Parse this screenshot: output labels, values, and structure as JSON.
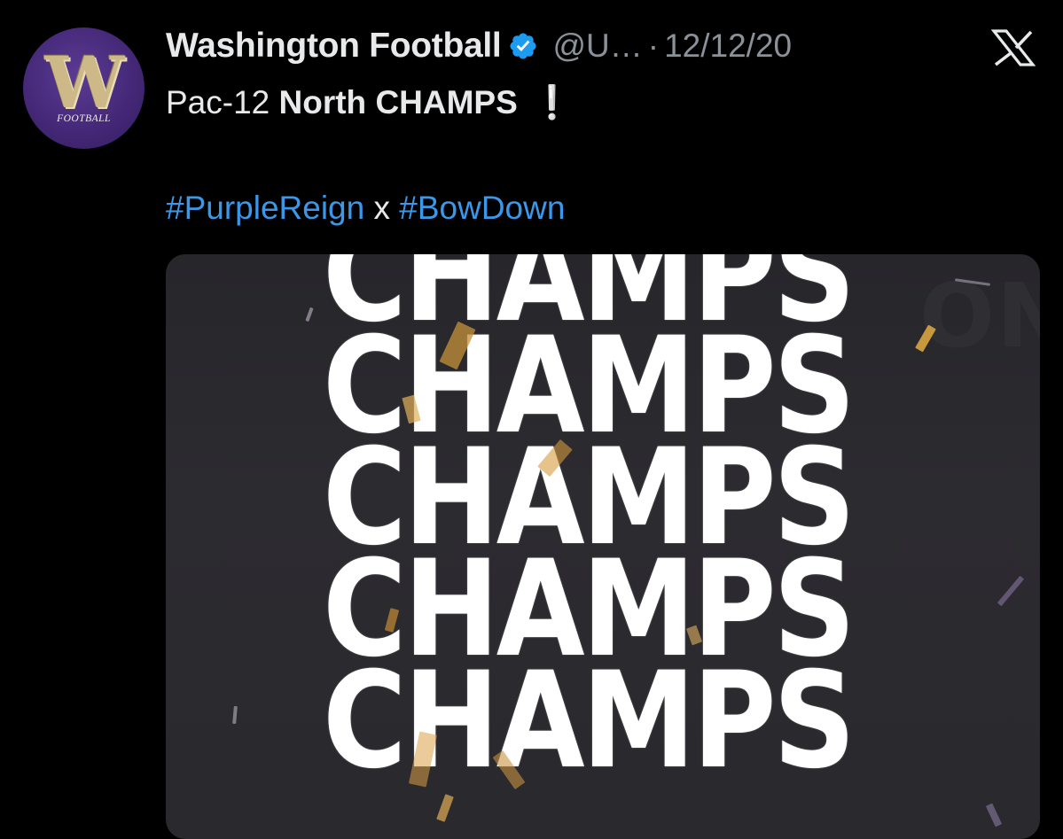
{
  "tweet": {
    "display_name": "Washington Football",
    "handle": "@U…",
    "separator": "·",
    "date": "12/12/20",
    "line1_plain": "Pac-12 ",
    "line1_bold": "North CHAMPS",
    "line1_emoji": "❕",
    "hashtags": [
      "#PurpleReign",
      "#BowDown"
    ],
    "joiner": "x"
  },
  "avatar": {
    "letter": "W",
    "subtext": "FOOTBALL"
  },
  "media": {
    "words": [
      "CHAMPS",
      "CHAMPS",
      "CHAMPS",
      "CHAMPS",
      "CHAMPS"
    ],
    "ghost_text": "ONS"
  },
  "icons": {
    "verified": "verified-badge-icon",
    "platform": "x-logo-icon"
  },
  "colors": {
    "background": "#000000",
    "hashtag": "#3b98e9",
    "verified": "#1d9bf0",
    "avatar_purple": "#3f2470",
    "avatar_gold": "#cdb888",
    "media_bg": "#2a292e",
    "confetti_gold": "#d9a441"
  }
}
